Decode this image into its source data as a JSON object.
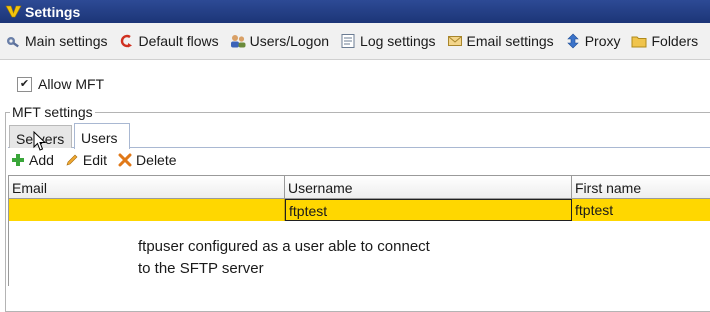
{
  "window": {
    "title": "Settings",
    "logo_icon": "v-logo-icon",
    "accent": "#1f3a80"
  },
  "menu": [
    {
      "label": "Main settings",
      "icon": "gear-wrench-icon"
    },
    {
      "label": "Default flows",
      "icon": "flow-arrow-icon"
    },
    {
      "label": "Users/Logon",
      "icon": "users-icon"
    },
    {
      "label": "Log settings",
      "icon": "log-document-icon"
    },
    {
      "label": "Email settings",
      "icon": "envelope-icon"
    },
    {
      "label": "Proxy",
      "icon": "proxy-arrows-icon"
    },
    {
      "label": "Folders",
      "icon": "folder-icon"
    }
  ],
  "allow_mft": {
    "label": "Allow MFT",
    "checked": true
  },
  "mft_settings": {
    "legend": "MFT settings",
    "tabs": [
      {
        "label": "Servers",
        "active": false
      },
      {
        "label": "Users",
        "active": true
      }
    ],
    "actions": [
      {
        "label": "Add",
        "icon": "plus-icon"
      },
      {
        "label": "Edit",
        "icon": "pencil-icon"
      },
      {
        "label": "Delete",
        "icon": "delete-x-icon"
      }
    ],
    "grid": {
      "columns": [
        "Email",
        "Username",
        "First name"
      ],
      "rows": [
        {
          "email": "",
          "username": "ftptest",
          "first_name": "ftptest"
        }
      ],
      "selected_row_color": "#ffd700"
    }
  },
  "annotation": {
    "line1": "ftpuser configured as a user able to connect",
    "line2": "to the SFTP server"
  }
}
